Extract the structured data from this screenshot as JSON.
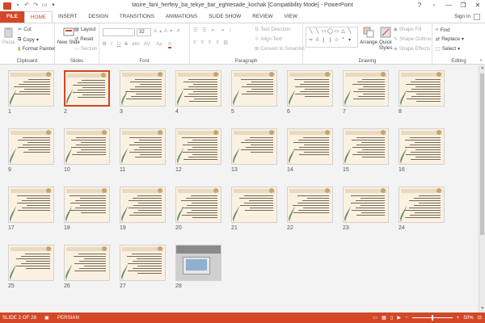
{
  "window": {
    "title": "tasire_fani_herfeiy_ba_tekye_bar_eghtesade_kochak [Compatibility Mode] - PowerPoint",
    "minimize": "—",
    "maximize": "❐",
    "close": "✕",
    "help": "?"
  },
  "tabs": [
    "FILE",
    "HOME",
    "INSERT",
    "DESIGN",
    "TRANSITIONS",
    "ANIMATIONS",
    "SLIDE SHOW",
    "REVIEW",
    "VIEW"
  ],
  "active_tab": "HOME",
  "signin": "Sign in",
  "ribbon": {
    "clipboard": {
      "paste": "Paste",
      "cut": "Cut",
      "copy": "Copy",
      "format_painter": "Format Painter",
      "label": "Clipboard"
    },
    "slides": {
      "new_slide": "New Slide",
      "layout": "Layout",
      "reset": "Reset",
      "section": "Section",
      "label": "Slides"
    },
    "font": {
      "size": "32",
      "bold": "B",
      "italic": "I",
      "underline": "U",
      "strike": "S",
      "shadow": "abc",
      "spacing": "AV",
      "case": "Aa",
      "color": "A",
      "label": "Font"
    },
    "paragraph": {
      "text_direction": "Text Direction",
      "align_text": "Align Text",
      "convert_smartart": "Convert to SmartArt",
      "label": "Paragraph"
    },
    "drawing": {
      "arrange": "Arrange",
      "quick_styles": "Quick Styles",
      "shape_fill": "Shape Fill",
      "shape_outline": "Shape Outline",
      "shape_effects": "Shape Effects",
      "label": "Drawing"
    },
    "editing": {
      "find": "Find",
      "replace": "Replace",
      "select": "Select",
      "label": "Editing"
    }
  },
  "slides": [
    {
      "num": "1"
    },
    {
      "num": "2",
      "selected": true
    },
    {
      "num": "3"
    },
    {
      "num": "4"
    },
    {
      "num": "5"
    },
    {
      "num": "6"
    },
    {
      "num": "7"
    },
    {
      "num": "8"
    },
    {
      "num": "9"
    },
    {
      "num": "10"
    },
    {
      "num": "11"
    },
    {
      "num": "12"
    },
    {
      "num": "13"
    },
    {
      "num": "14"
    },
    {
      "num": "15"
    },
    {
      "num": "16"
    },
    {
      "num": "17"
    },
    {
      "num": "18"
    },
    {
      "num": "19"
    },
    {
      "num": "20"
    },
    {
      "num": "21"
    },
    {
      "num": "22"
    },
    {
      "num": "23"
    },
    {
      "num": "24"
    },
    {
      "num": "25"
    },
    {
      "num": "26"
    },
    {
      "num": "27"
    },
    {
      "num": "28",
      "photo": true
    }
  ],
  "status": {
    "slide_info": "SLIDE 2 OF 28",
    "language": "PERSIAN",
    "zoom_minus": "−",
    "zoom_plus": "+",
    "zoom": "50%"
  },
  "colors": {
    "accent": "#d24726",
    "slide_bg": "#fbf1e1"
  }
}
